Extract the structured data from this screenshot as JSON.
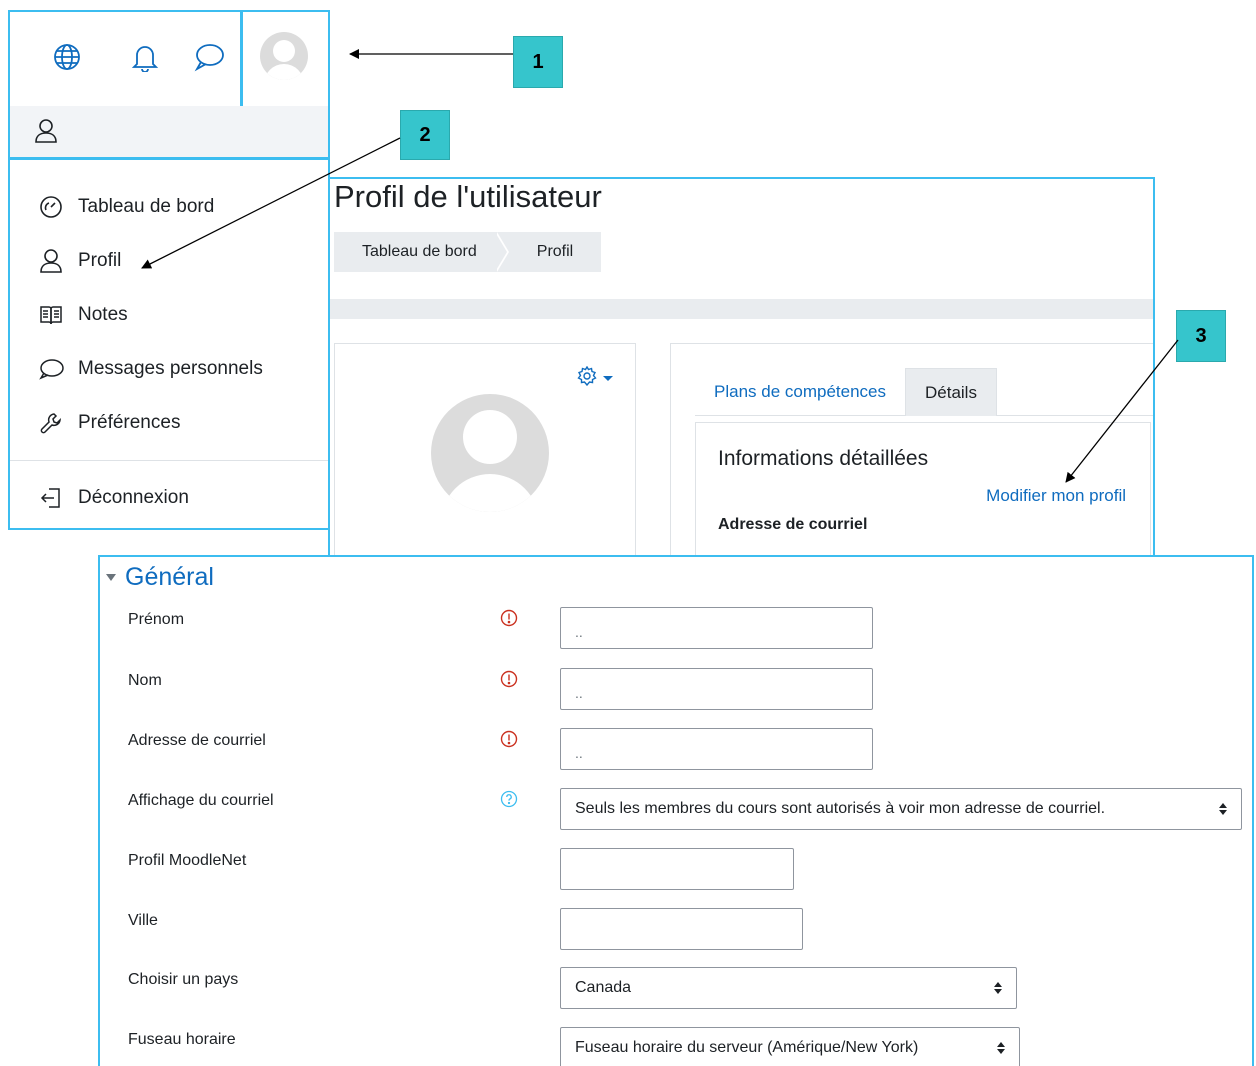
{
  "callouts": [
    "1",
    "2",
    "3"
  ],
  "user_menu": {
    "items": [
      {
        "label": "Tableau de bord",
        "icon": "dashboard-gauge-icon"
      },
      {
        "label": "Profil",
        "icon": "user-icon"
      },
      {
        "label": "Notes",
        "icon": "grades-book-icon"
      },
      {
        "label": "Messages personnels",
        "icon": "chat-bubble-icon"
      },
      {
        "label": "Préférences",
        "icon": "wrench-icon"
      }
    ],
    "logout": {
      "label": "Déconnexion",
      "icon": "sign-out-icon"
    }
  },
  "profile": {
    "title": "Profil de l'utilisateur",
    "breadcrumb": [
      "Tableau de bord",
      "Profil"
    ],
    "tabs": [
      {
        "label": "Plans de compétences",
        "active": false
      },
      {
        "label": "Détails",
        "active": true
      }
    ],
    "info_title": "Informations détaillées",
    "edit_link": "Modifier mon profil",
    "email_label": "Adresse de courriel"
  },
  "form": {
    "section_title": "Général",
    "fields": [
      {
        "label": "Prénom",
        "mark": "required",
        "value": ".."
      },
      {
        "label": "Nom",
        "mark": "required",
        "value": ".."
      },
      {
        "label": "Adresse de courriel",
        "mark": "required",
        "value": ".."
      },
      {
        "label": "Affichage du courriel",
        "mark": "help",
        "value": "Seuls les membres du cours sont autorisés à voir mon adresse de courriel."
      },
      {
        "label": "Profil MoodleNet",
        "mark": "",
        "value": ""
      },
      {
        "label": "Ville",
        "mark": "",
        "value": ""
      },
      {
        "label": "Choisir un pays",
        "mark": "",
        "value": "Canada"
      },
      {
        "label": "Fuseau horaire",
        "mark": "",
        "value": "Fuseau horaire du serveur (Amérique/New York)"
      }
    ]
  },
  "colors": {
    "highlight_border": "#3cbdf0",
    "link": "#0f6cbf",
    "required": "#ca3120",
    "help": "#3cbdf0",
    "callout_bg": "#36c5cc"
  }
}
